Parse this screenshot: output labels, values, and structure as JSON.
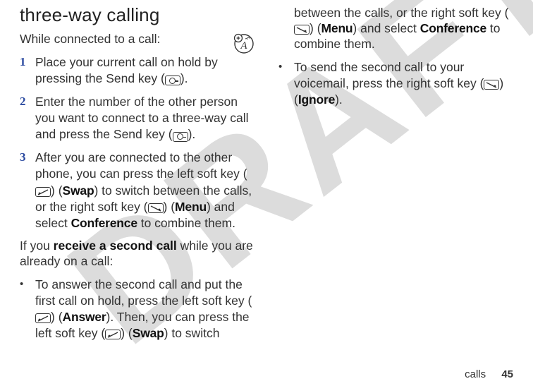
{
  "watermark": "DRAFT",
  "section": {
    "title": "three-way calling"
  },
  "left": {
    "intro": "While connected to a call:",
    "badge_icon": "account-plus-icon",
    "steps": [
      {
        "num": "1",
        "pre": "Place your current call on hold by pressing the Send key (",
        "key": "send-key-icon",
        "post": ")."
      },
      {
        "num": "2",
        "pre": "Enter the number of the other person you want to connect to a three-way call and press the Send key (",
        "key": "send-key-icon",
        "post": ")."
      },
      {
        "num": "3",
        "part1": "After you are connected to the other phone, you can press the left soft key (",
        "swap_label": "Swap",
        "part2": ") to switch between the calls, or the right soft key (",
        "menu_label": "Menu",
        "part3": ") and select ",
        "conference_label": "Conference",
        "part4": " to combine them."
      }
    ],
    "receive_lead_pre": "If you ",
    "receive_bold": "receive a second call",
    "receive_lead_post": " while you are already on a call:",
    "bullets": [
      {
        "part1": "To answer the second call and put the first call on hold, press the left soft key (",
        "answer_label": "Answer",
        "part2": "). Then, you can press the left soft key (",
        "swap_label": "Swap",
        "part3": ") to switch"
      }
    ]
  },
  "right": {
    "cont": {
      "part1": "between the calls, or the right soft key (",
      "menu_label": "Menu",
      "part2": ") and select ",
      "conference_label": "Conference",
      "part3": " to combine them."
    },
    "bullet2": {
      "part1": "To send the second call to your voicemail, press the right soft key (",
      "ignore_label": "Ignore",
      "part2": ")."
    }
  },
  "footer": {
    "section": "calls",
    "page": "45"
  }
}
